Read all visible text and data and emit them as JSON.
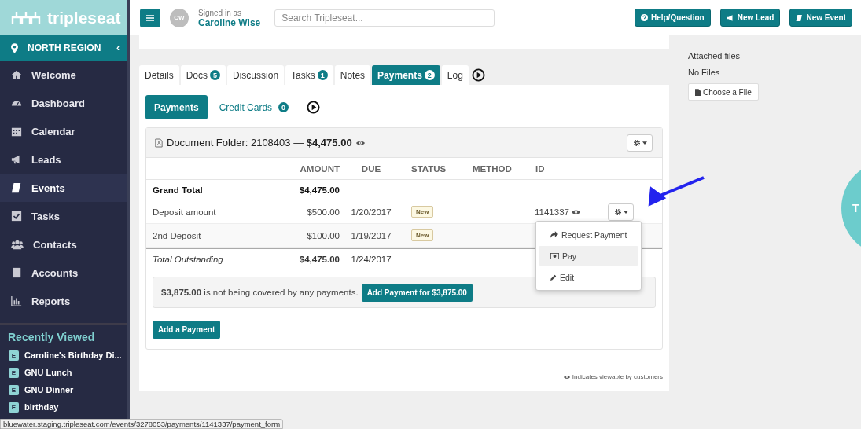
{
  "sidebar": {
    "logo": "tripleseat",
    "region": "NORTH REGION",
    "collapse": "‹",
    "nav": [
      {
        "label": "Welcome",
        "selected": false
      },
      {
        "label": "Dashboard",
        "selected": false
      },
      {
        "label": "Calendar",
        "selected": false
      },
      {
        "label": "Leads",
        "selected": false
      },
      {
        "label": "Events",
        "selected": true
      },
      {
        "label": "Tasks",
        "selected": false
      },
      {
        "label": "Contacts",
        "selected": false
      },
      {
        "label": "Accounts",
        "selected": false
      },
      {
        "label": "Reports",
        "selected": false
      }
    ],
    "recent_title": "Recently Viewed",
    "recent": [
      {
        "badge": "E",
        "label": "Caroline's Birthday Di..."
      },
      {
        "badge": "E",
        "label": "GNU Lunch"
      },
      {
        "badge": "E",
        "label": "GNU Dinner"
      },
      {
        "badge": "E",
        "label": "birthday"
      }
    ]
  },
  "topbar": {
    "avatar": "CW",
    "signed_in_label": "Signed in as",
    "user": "Caroline Wise",
    "search": {
      "placeholder": "Search Tripleseat..."
    },
    "buttons": [
      {
        "label": "Help/Question"
      },
      {
        "label": "New Lead"
      },
      {
        "label": "New Event"
      }
    ]
  },
  "tabs": [
    {
      "label": "Details",
      "selected": false
    },
    {
      "label": "Docs",
      "count": "5",
      "selected": false
    },
    {
      "label": "Discussion",
      "selected": false
    },
    {
      "label": "Tasks",
      "count": "1",
      "selected": false
    },
    {
      "label": "Notes",
      "selected": false
    },
    {
      "label": "Payments",
      "count": "2",
      "selected": true
    },
    {
      "label": "Log",
      "selected": false
    }
  ],
  "subtabs": [
    {
      "label": "Payments",
      "selected": true
    },
    {
      "label": "Credit Cards",
      "count": "0",
      "selected": false
    }
  ],
  "folder": {
    "title": "Document Folder: 2108403 — **$4,475.00**"
  },
  "table": {
    "columns": [
      "AMOUNT",
      "DUE",
      "STATUS",
      "METHOD",
      "ID"
    ],
    "rows": [
      {
        "kind": "total",
        "label": "Grand Total",
        "amount": "$4,475.00"
      },
      {
        "kind": "payment",
        "label": "Deposit amount",
        "amount": "$500.00",
        "due": "1/20/2017",
        "status": "New",
        "id": "1141337"
      },
      {
        "kind": "payment",
        "label": "2nd Deposit",
        "amount": "$100.00",
        "due": "1/19/2017",
        "status": "New"
      },
      {
        "kind": "outstanding",
        "label": "Total Outstanding",
        "amount": "$4,475.00",
        "due": "1/24/2017"
      }
    ]
  },
  "menu": {
    "items": [
      {
        "label": "Request Payment",
        "selected": false
      },
      {
        "label": "Pay",
        "selected": true
      },
      {
        "label": "Edit",
        "selected": false
      }
    ]
  },
  "notice": {
    "text": "**$3,875.00** is not being covered by any payments.",
    "button": "Add Payment for $3,875.00"
  },
  "add_button": "Add a Payment",
  "footnote": "Indicates viewable by customers",
  "aside": {
    "title": "Attached files",
    "empty": "No Files",
    "button": "Choose a File"
  },
  "help_circle": "T",
  "status_url": "bluewater.staging.tripleseat.com/events/3278053/payments/1141337/payment_form"
}
